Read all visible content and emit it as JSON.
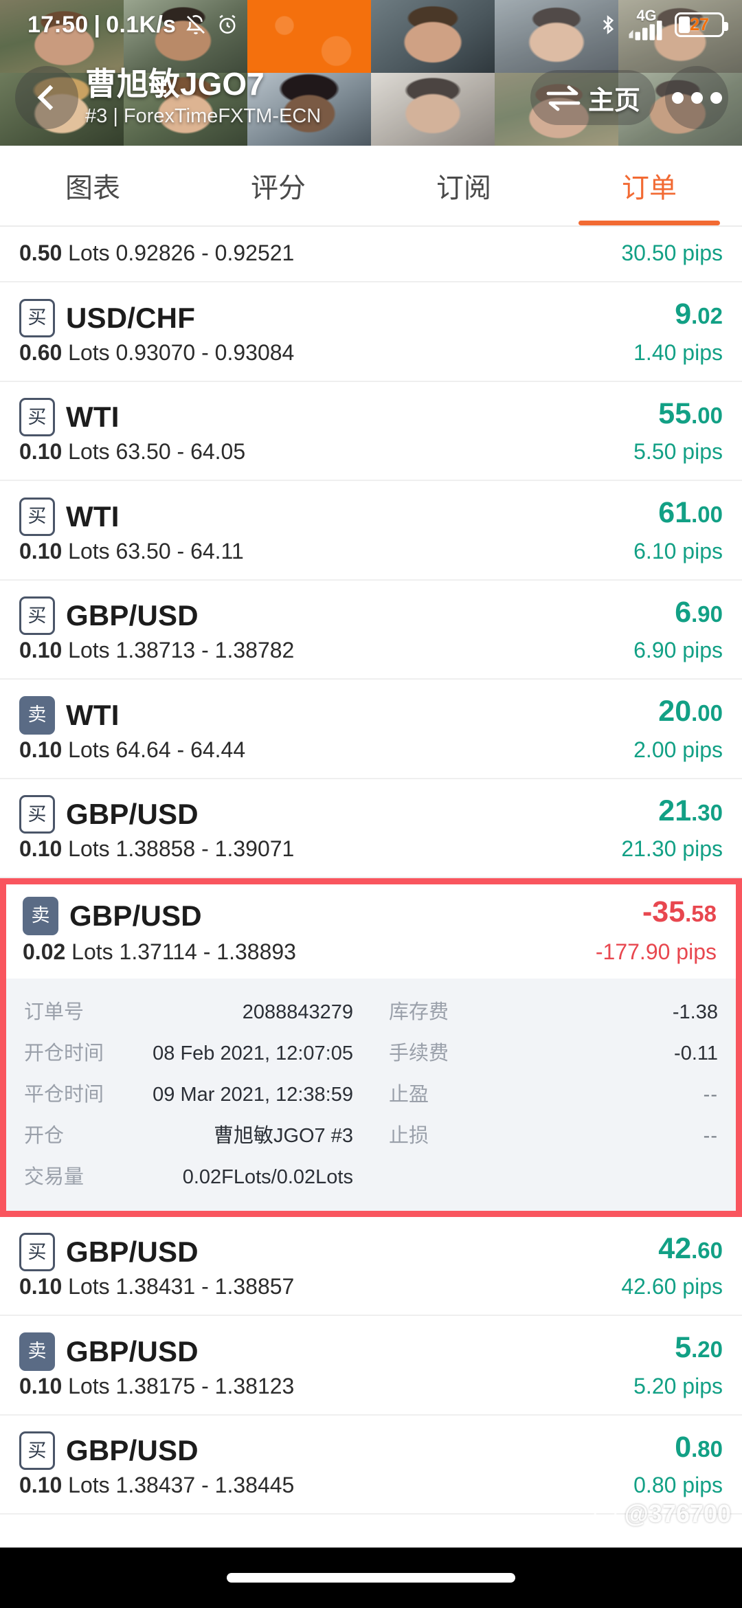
{
  "status_bar": {
    "time": "17:50",
    "separator": "|",
    "network_speed": "0.1K/s",
    "mute_icon": "bell-muted-icon",
    "alarm_icon": "alarm-clock-icon",
    "bluetooth_icon": "bluetooth-icon",
    "network_type": "4G",
    "signal_icon": "signal-bars-icon",
    "battery_percent": "27",
    "battery_level": 27
  },
  "header": {
    "back_icon": "back-chevron-icon",
    "account_name": "曹旭敏JGO7",
    "account_sub": "#3 | ForexTimeFXTM-ECN",
    "home_button_label": "主页",
    "home_button_icon": "exchange-arrows-icon",
    "more_button_icon": "more-dots-icon"
  },
  "tabs": [
    {
      "label": "图表",
      "name": "tab-chart",
      "active": false
    },
    {
      "label": "评分",
      "name": "tab-rating",
      "active": false
    },
    {
      "label": "订阅",
      "name": "tab-subscribe",
      "active": false
    },
    {
      "label": "订单",
      "name": "tab-orders",
      "active": true
    }
  ],
  "labels": {
    "lots": "Lots",
    "pips": "pips",
    "dash": "-"
  },
  "colors": {
    "accent": "#f26a33",
    "profit": "#12a085",
    "loss": "#e8474f",
    "highlight_border": "#f9555e",
    "sell_badge": "#5a6b85",
    "detail_bg": "#f2f4f7",
    "status_bar_bg": "#f4700d"
  },
  "orders": [
    {
      "partial": true,
      "side": "",
      "side_label": "",
      "symbol": "",
      "profit_int": "",
      "profit_dec": "",
      "profit_sign": "pos",
      "volume": "0.50",
      "price_open": "0.92826",
      "price_close": "0.92521",
      "pips": "30.50"
    },
    {
      "partial": false,
      "side": "buy",
      "side_label": "买",
      "symbol": "USD/CHF",
      "profit_int": "9",
      "profit_dec": ".02",
      "profit_sign": "pos",
      "volume": "0.60",
      "price_open": "0.93070",
      "price_close": "0.93084",
      "pips": "1.40"
    },
    {
      "partial": false,
      "side": "buy",
      "side_label": "买",
      "symbol": "WTI",
      "profit_int": "55",
      "profit_dec": ".00",
      "profit_sign": "pos",
      "volume": "0.10",
      "price_open": "63.50",
      "price_close": "64.05",
      "pips": "5.50"
    },
    {
      "partial": false,
      "side": "buy",
      "side_label": "买",
      "symbol": "WTI",
      "profit_int": "61",
      "profit_dec": ".00",
      "profit_sign": "pos",
      "volume": "0.10",
      "price_open": "63.50",
      "price_close": "64.11",
      "pips": "6.10"
    },
    {
      "partial": false,
      "side": "buy",
      "side_label": "买",
      "symbol": "GBP/USD",
      "profit_int": "6",
      "profit_dec": ".90",
      "profit_sign": "pos",
      "volume": "0.10",
      "price_open": "1.38713",
      "price_close": "1.38782",
      "pips": "6.90"
    },
    {
      "partial": false,
      "side": "sell",
      "side_label": "卖",
      "symbol": "WTI",
      "profit_int": "20",
      "profit_dec": ".00",
      "profit_sign": "pos",
      "volume": "0.10",
      "price_open": "64.64",
      "price_close": "64.44",
      "pips": "2.00"
    },
    {
      "partial": false,
      "side": "buy",
      "side_label": "买",
      "symbol": "GBP/USD",
      "profit_int": "21",
      "profit_dec": ".30",
      "profit_sign": "pos",
      "volume": "0.10",
      "price_open": "1.38858",
      "price_close": "1.39071",
      "pips": "21.30"
    }
  ],
  "expanded_order": {
    "side": "sell",
    "side_label": "卖",
    "symbol": "GBP/USD",
    "profit_int": "-35",
    "profit_dec": ".58",
    "profit_sign": "neg",
    "volume": "0.02",
    "price_open": "1.37114",
    "price_close": "1.38893",
    "pips": "-177.90",
    "details_left": [
      {
        "label": "订单号",
        "value": "2088843279",
        "muted": false
      },
      {
        "label": "开仓时间",
        "value": "08 Feb 2021, 12:07:05",
        "muted": false
      },
      {
        "label": "平仓时间",
        "value": "09 Mar 2021, 12:38:59",
        "muted": false
      },
      {
        "label": "开仓",
        "value": "曹旭敏JGO7  #3",
        "muted": false
      },
      {
        "label": "交易量",
        "value": "0.02FLots/0.02Lots",
        "muted": false
      }
    ],
    "details_right": [
      {
        "label": "库存费",
        "value": "-1.38",
        "muted": false
      },
      {
        "label": "手续费",
        "value": "-0.11",
        "muted": false
      },
      {
        "label": "止盈",
        "value": "--",
        "muted": true
      },
      {
        "label": "止损",
        "value": "--",
        "muted": true
      }
    ]
  },
  "orders_after": [
    {
      "partial": false,
      "side": "buy",
      "side_label": "买",
      "symbol": "GBP/USD",
      "profit_int": "42",
      "profit_dec": ".60",
      "profit_sign": "pos",
      "volume": "0.10",
      "price_open": "1.38431",
      "price_close": "1.38857",
      "pips": "42.60"
    },
    {
      "partial": false,
      "side": "sell",
      "side_label": "卖",
      "symbol": "GBP/USD",
      "profit_int": "5",
      "profit_dec": ".20",
      "profit_sign": "pos",
      "volume": "0.10",
      "price_open": "1.38175",
      "price_close": "1.38123",
      "pips": "5.20"
    },
    {
      "partial": false,
      "side": "buy",
      "side_label": "买",
      "symbol": "GBP/USD",
      "profit_int": "0",
      "profit_dec": ".80",
      "profit_sign": "pos",
      "volume": "0.10",
      "price_open": "1.38437",
      "price_close": "1.38445",
      "pips": "0.80"
    }
  ],
  "watermark": {
    "icon": "chat-bubble-icon",
    "text": "@376700"
  }
}
